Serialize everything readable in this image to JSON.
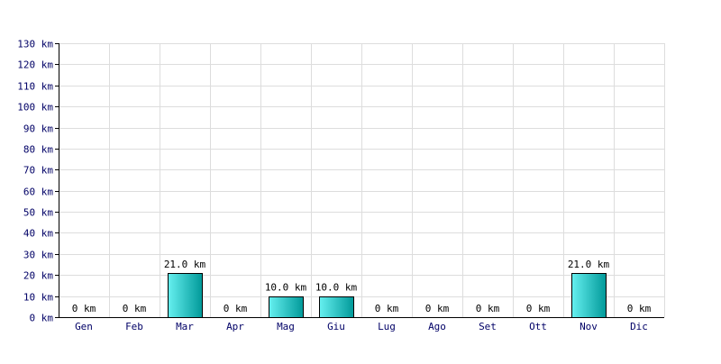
{
  "chart_data": {
    "type": "bar",
    "categories": [
      "Gen",
      "Feb",
      "Mar",
      "Apr",
      "Mag",
      "Giu",
      "Lug",
      "Ago",
      "Set",
      "Ott",
      "Nov",
      "Dic"
    ],
    "values": [
      0,
      0,
      21,
      0,
      10,
      10,
      0,
      0,
      0,
      0,
      21,
      0
    ],
    "data_labels": [
      "0 km",
      "0 km",
      "21.0 km",
      "0 km",
      "10.0 km",
      "10.0 km",
      "0 km",
      "0 km",
      "0 km",
      "0 km",
      "21.0 km",
      "0 km"
    ],
    "y_ticks": [
      0,
      10,
      20,
      30,
      40,
      50,
      60,
      70,
      80,
      90,
      100,
      110,
      120,
      130
    ],
    "y_tick_labels": [
      "0 km",
      "10 km",
      "20 km",
      "30 km",
      "40 km",
      "50 km",
      "60 km",
      "70 km",
      "80 km",
      "90 km",
      "100 km",
      "110 km",
      "120 km",
      "130 km"
    ],
    "ylim": [
      0,
      130
    ],
    "grid": true,
    "colors": {
      "bar_light": "#66f0f0",
      "bar_dark": "#009999",
      "axis_text": "#000066",
      "grid": "#dddddd",
      "axis": "#000000"
    }
  }
}
